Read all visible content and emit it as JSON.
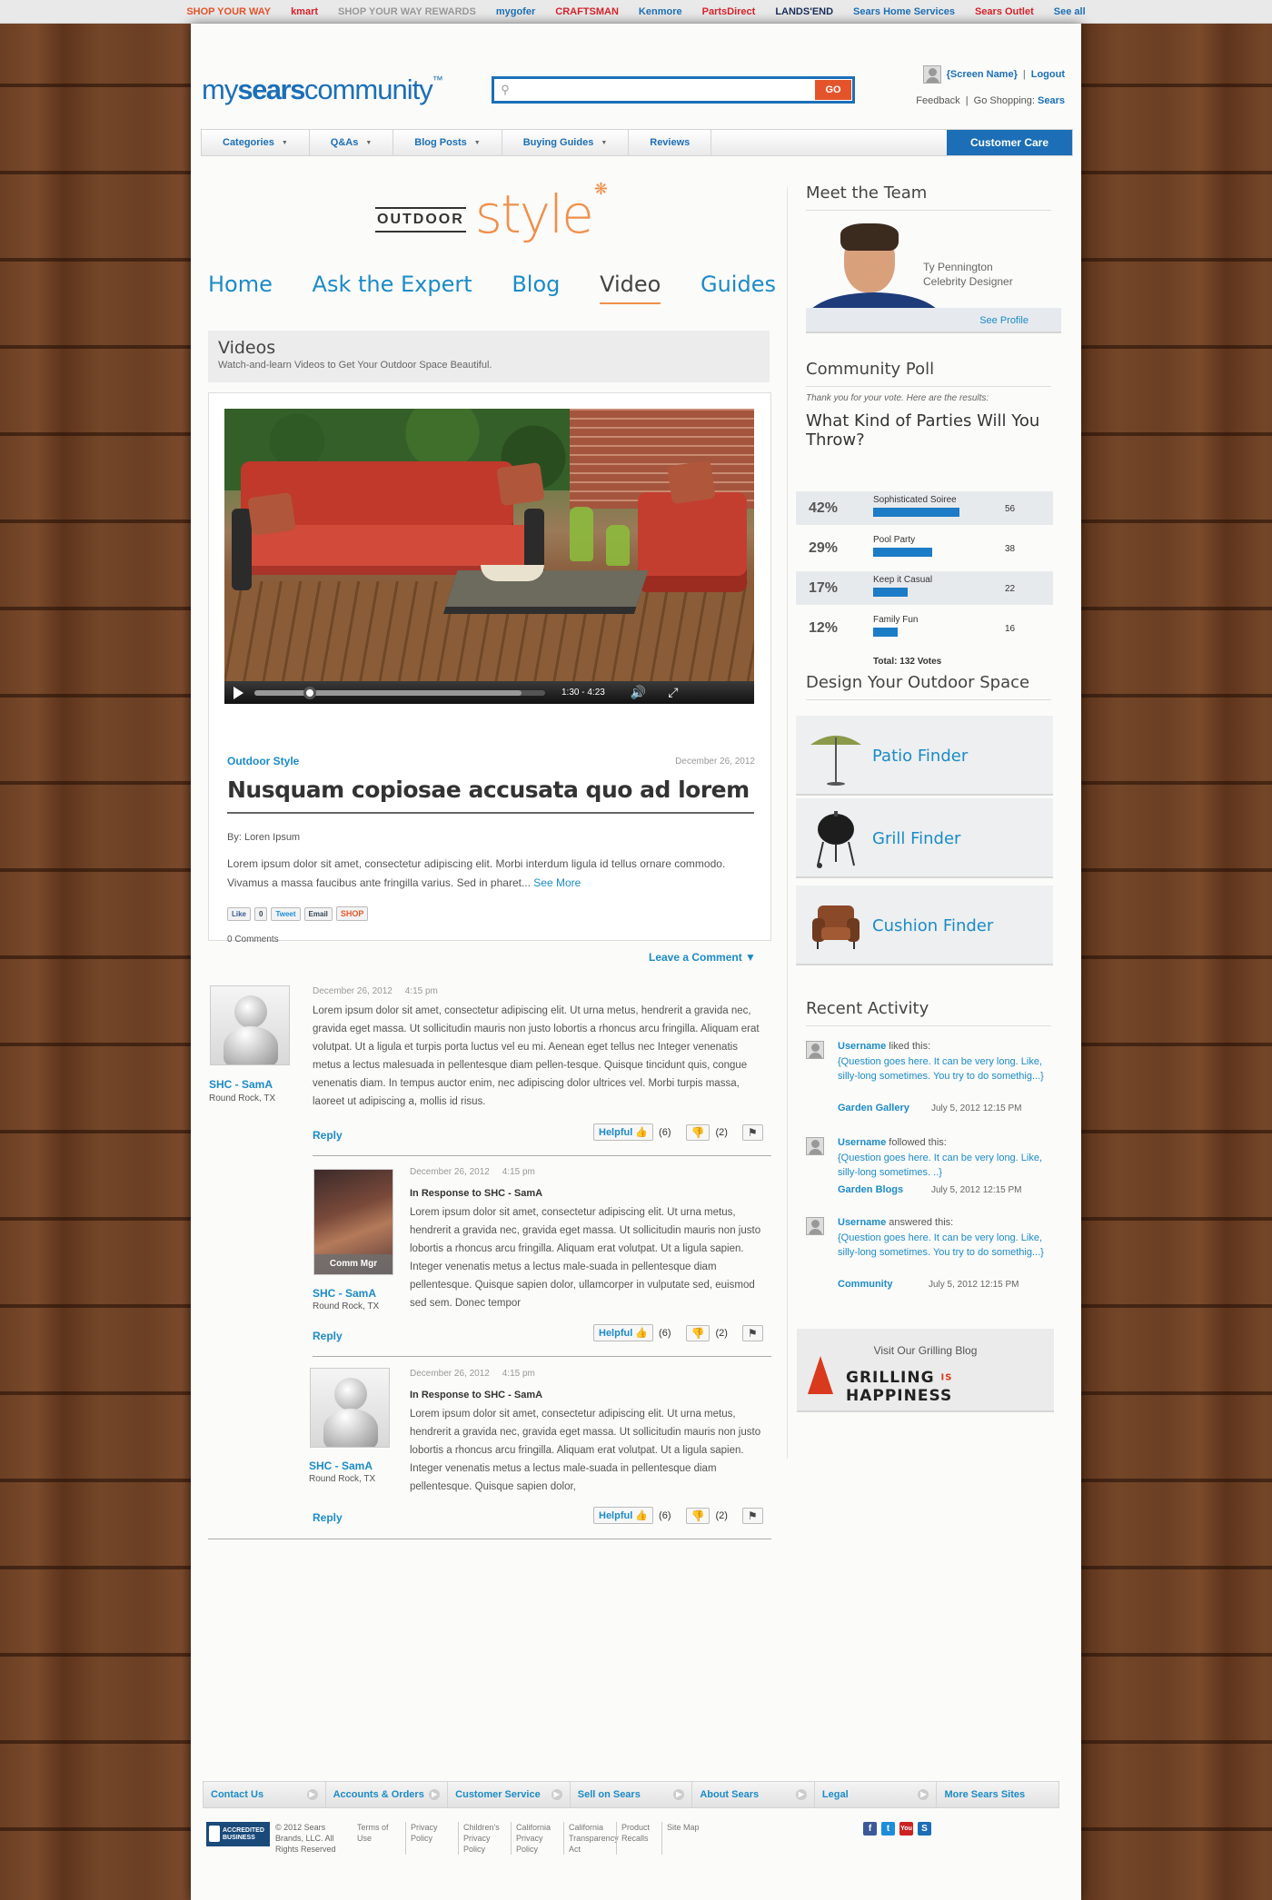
{
  "brands": [
    {
      "label": "SHOP YOUR WAY",
      "color": "#e4542b"
    },
    {
      "label": "kmart",
      "color": "#d8222a"
    },
    {
      "label": "SHOP YOUR WAY REWARDS",
      "color": "#999999"
    },
    {
      "label": "mygofer",
      "color": "#1c6fb6"
    },
    {
      "label": "CRAFTSMAN",
      "color": "#d8222a"
    },
    {
      "label": "Kenmore",
      "color": "#1c6fb6"
    },
    {
      "label": "PartsDirect",
      "color": "#d8222a"
    },
    {
      "label": "LANDS'END",
      "color": "#1a2d5a"
    },
    {
      "label": "Sears Home Services",
      "color": "#1c6fb6"
    },
    {
      "label": "Sears Outlet",
      "color": "#d8222a"
    },
    {
      "label": "See all",
      "color": "#1c6fb6"
    }
  ],
  "header": {
    "logo_my": "my",
    "logo_sears": "sears",
    "logo_community": "community",
    "logo_tm": "™",
    "search_placeholder": "",
    "search_button": "GO",
    "screen_name": "{Screen Name}",
    "logout": "Logout",
    "feedback": "Feedback",
    "go_shopping": "Go Shopping:",
    "shop_link": "Sears"
  },
  "nav": {
    "items": [
      "Categories",
      "Q&As",
      "Blog Posts",
      "Buying Guides"
    ],
    "reviews": "Reviews",
    "customer_care": "Customer Care"
  },
  "outdoor_style": {
    "outdoor": "OUTDOOR",
    "style": "style"
  },
  "subnav": {
    "home": "Home",
    "ask": "Ask the Expert",
    "blog": "Blog",
    "video": "Video",
    "guides": "Guides"
  },
  "videos": {
    "title": "Videos",
    "subtitle": "Watch-and-learn Videos to Get Your Outdoor Space Beautiful.",
    "time": "1:30 - 4:23",
    "progress": 0.17,
    "category": "Outdoor Style",
    "date": "December 26, 2012",
    "headline": "Nusquam copiosae accusata quo ad lorem",
    "byline": "By: Loren Ipsum",
    "description": "Lorem ipsum dolor sit amet, consectetur adipiscing elit. Morbi interdum ligula id tellus ornare commodo. Vivamus a massa faucibus ante fringilla varius. Sed in pharet...",
    "see_more": "See More",
    "share": {
      "like": "Like",
      "like_count": "0",
      "tweet": "Tweet",
      "email": "Email",
      "shop": "SHOP"
    },
    "comments_count": "0 Comments",
    "leave_comment": "Leave a Comment ▼"
  },
  "comments": [
    {
      "date": "December 26, 2012",
      "time": "4:15 pm",
      "name": "SHC - SamA",
      "location": "Round Rock, TX",
      "response": "",
      "text": "Lorem ipsum dolor sit amet, consectetur adipiscing elit. Ut urna metus, hendrerit a gravida nec, gravida eget massa. Ut sollicitudin mauris non justo lobortis a rhoncus arcu fringilla. Aliquam erat volutpat. Ut a ligula et turpis porta luctus vel eu mi. Aenean eget tellus nec Integer venenatis metus a lectus malesuada in pellentesque diam pellen-tesque. Quisque tincidunt quis, congue venenatis diam. In tempus auctor enim, nec adipiscing dolor ultrices vel. Morbi turpis massa, laoreet ut adipiscing a, mollis id risus.",
      "reply": "Reply",
      "helpful": "Helpful",
      "up_count": "(6)",
      "down_count": "(2)"
    },
    {
      "date": "December 26, 2012",
      "time": "4:15 pm",
      "name": "SHC - SamA",
      "location": "Round Rock, TX",
      "badge": "Comm Mgr",
      "response": "In Response to SHC - SamA",
      "text": "Lorem ipsum dolor sit amet, consectetur adipiscing elit. Ut urna metus, hendrerit a gravida nec, gravida eget massa. Ut sollicitudin mauris non justo lobortis a rhoncus arcu fringilla. Aliquam erat volutpat. Ut a ligula sapien. Integer venenatis metus a lectus male-suada in pellentesque diam pellentesque. Quisque sapien dolor, ullamcorper in vulputate sed, euismod sed sem. Donec tempor",
      "reply": "Reply",
      "helpful": "Helpful",
      "up_count": "(6)",
      "down_count": "(2)"
    },
    {
      "date": "December 26, 2012",
      "time": "4:15 pm",
      "name": "SHC - SamA",
      "location": "Round Rock, TX",
      "response": "In Response to SHC - SamA",
      "text": "Lorem ipsum dolor sit amet, consectetur adipiscing elit. Ut urna metus, hendrerit a gravida nec, gravida eget massa. Ut sollicitudin mauris non justo lobortis a rhoncus arcu fringilla. Aliquam erat volutpat. Ut a ligula sapien. Integer venenatis metus a lectus male-suada in pellentesque diam pellentesque. Quisque sapien dolor,",
      "reply": "Reply",
      "helpful": "Helpful",
      "up_count": "(6)",
      "down_count": "(2)"
    }
  ],
  "sidebar": {
    "team_title": "Meet the Team",
    "team_name": "Ty Pennington",
    "team_role": "Celebrity Designer",
    "see_profile": "See Profile",
    "poll_title": "Community Poll",
    "poll_thanks": "Thank you for your vote. Here are the results:",
    "poll_question": "What Kind of Parties Will You Throw?",
    "poll": [
      {
        "pct": "42%",
        "label": "Sophisticated Soiree",
        "count": "56",
        "share": 0.42
      },
      {
        "pct": "29%",
        "label": "Pool Party",
        "count": "38",
        "share": 0.29
      },
      {
        "pct": "17%",
        "label": "Keep it Casual",
        "count": "22",
        "share": 0.17
      },
      {
        "pct": "12%",
        "label": "Family Fun",
        "count": "16",
        "share": 0.12
      }
    ],
    "poll_total": "Total: 132 Votes",
    "design_title": "Design Your Outdoor Space",
    "finders": [
      "Patio Finder",
      "Grill Finder",
      "Cushion Finder"
    ],
    "activity_title": "Recent Activity",
    "activity": [
      {
        "user": "Username",
        "verb": "liked this:",
        "question": "{Question goes here. It can be very long. Like, silly-long sometimes. You try to do somethig...}",
        "source": "Garden Gallery",
        "time": "July 5, 2012 12:15 PM"
      },
      {
        "user": "Username",
        "verb": "followed this:",
        "question": "{Question goes here. It can be very long. Like, silly-long sometimes. ..}",
        "source": "Garden Blogs",
        "time": "July 5, 2012 12:15 PM"
      },
      {
        "user": "Username",
        "verb": "answered this:",
        "question": "{Question goes here. It can be very long. Like, silly-long sometimes. You try to do somethig...}",
        "source": "Community",
        "time": "July 5, 2012 12:15 PM"
      }
    ],
    "grill_visit": "Visit Our Grilling Blog",
    "grill_a": "GRILLING",
    "grill_is": "IS",
    "grill_b": "HAPPINESS"
  },
  "footer": {
    "nav": [
      "Contact Us",
      "Accounts & Orders",
      "Customer Service",
      "Sell on Sears",
      "About Sears",
      "Legal",
      "More Sears Sites"
    ],
    "bbb": "ACCREDITED BUSINESS",
    "copyright": "© 2012 Sears Brands, LLC. All Rights Reserved",
    "links": [
      "Terms of Use",
      "Privacy Policy",
      "Children's Privacy Policy",
      "California Privacy Policy",
      "California Transparency Act",
      "Product Recalls",
      "Site Map"
    ],
    "social": [
      "f",
      "t",
      "You",
      "S"
    ]
  }
}
